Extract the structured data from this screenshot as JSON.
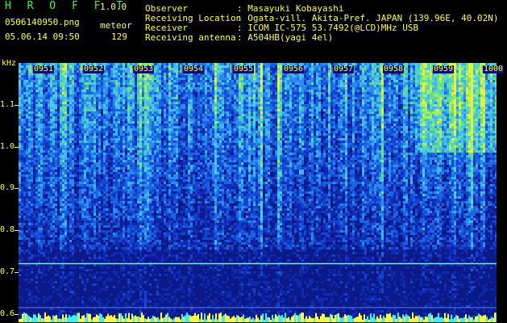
{
  "app": {
    "name": "H R O F F T",
    "version": "1.0.0"
  },
  "file": {
    "name": "0506140950.png",
    "datetime": "05.06.14 09:50"
  },
  "detection": {
    "label": "meteor",
    "count": "129"
  },
  "info": [
    {
      "label": "Observer",
      "value": ": Masayuki Kobayashi"
    },
    {
      "label": "Receiving Location",
      "value": ": Ogata-vill. Akita-Pref. JAPAN (139.96E, 40.02N)"
    },
    {
      "label": "Receiver",
      "value": ": ICOM IC-575 53.7492(@LCD)MHz USB"
    },
    {
      "label": "Receiving antenna",
      "value": ": A504HB(yagi 4el)"
    }
  ],
  "axis": {
    "unit": "kHz",
    "y_ticks": [
      "1.1",
      "1.0",
      "0.9",
      "0.8",
      "0.7",
      "0.6"
    ],
    "y_values": [
      1.1,
      1.0,
      0.9,
      0.8,
      0.7,
      0.6
    ],
    "y_range": [
      0.58,
      1.2
    ],
    "time_labels": [
      "0951",
      "0952",
      "0953",
      "0954",
      "0955",
      "0956",
      "0957",
      "0958",
      "0959",
      "1000"
    ]
  },
  "colors": {
    "label": "#ffff3c",
    "info": "#32ff32",
    "background": "#000000",
    "spectrogram_base": "#0a1466"
  },
  "spectrogram": {
    "carrier_khz": 0.72
  }
}
